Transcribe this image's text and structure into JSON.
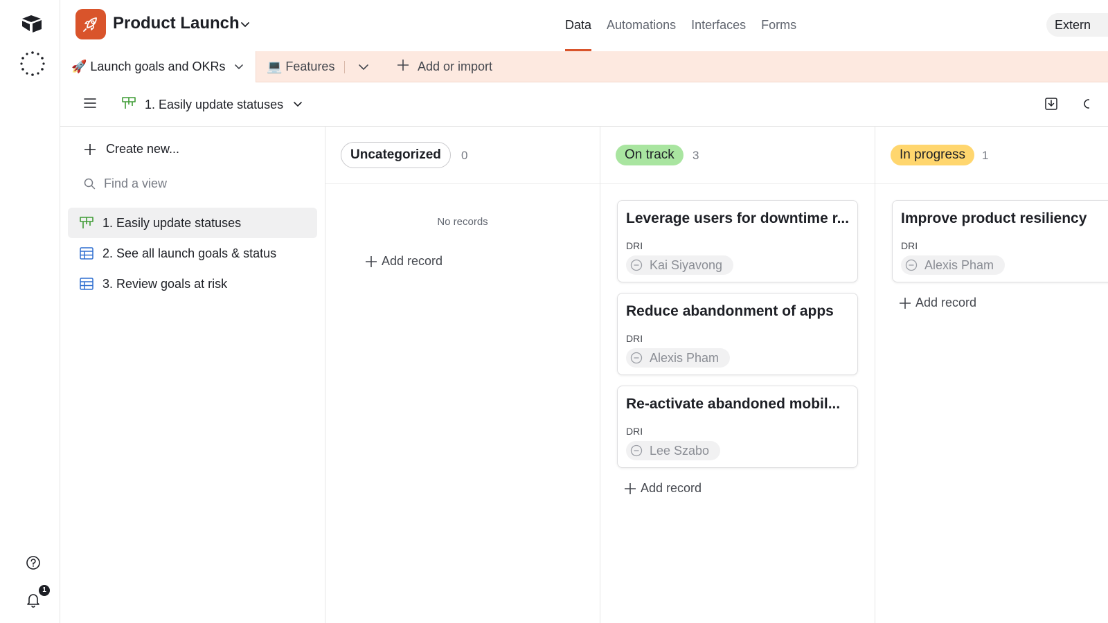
{
  "app": {
    "base_name": "Product Launch",
    "nav_tabs": [
      "Data",
      "Automations",
      "Interfaces",
      "Forms"
    ],
    "active_nav": "Data",
    "external_button": "Extern",
    "notifications_count": "1",
    "accent_color": "#d9542b"
  },
  "tables": {
    "active": "🚀 Launch goals and OKRs",
    "second": "💻 Features",
    "add_import": "Add or import"
  },
  "view": {
    "current": "1. Easily update statuses"
  },
  "sidebar": {
    "create_new": "Create new...",
    "find_placeholder": "Find a view",
    "views": [
      {
        "label": "1. Easily update statuses",
        "icon": "kanban-icon"
      },
      {
        "label": "2. See all launch goals & status",
        "icon": "grid-icon"
      },
      {
        "label": "3. Review goals at risk",
        "icon": "grid-icon"
      }
    ]
  },
  "board": {
    "stacks": [
      {
        "label": "Uncategorized",
        "count": "0",
        "empty_text": "No records",
        "add_record": "Add record",
        "color": "#ffffff",
        "cards": []
      },
      {
        "label": "On track",
        "count": "3",
        "add_record": "Add record",
        "color": "#a9e5a0",
        "cards": [
          {
            "title": "Leverage users for downtime r...",
            "field_label": "DRI",
            "person": "Kai Siyavong"
          },
          {
            "title": "Reduce abandonment of apps",
            "field_label": "DRI",
            "person": "Alexis Pham"
          },
          {
            "title": "Re-activate abandoned mobil...",
            "field_label": "DRI",
            "person": "Lee Szabo"
          }
        ]
      },
      {
        "label": "In progress",
        "count": "1",
        "add_record": "Add record",
        "color": "#ffd66e",
        "cards": [
          {
            "title": "Improve product resiliency",
            "field_label": "DRI",
            "person": "Alexis Pham"
          }
        ]
      }
    ]
  }
}
